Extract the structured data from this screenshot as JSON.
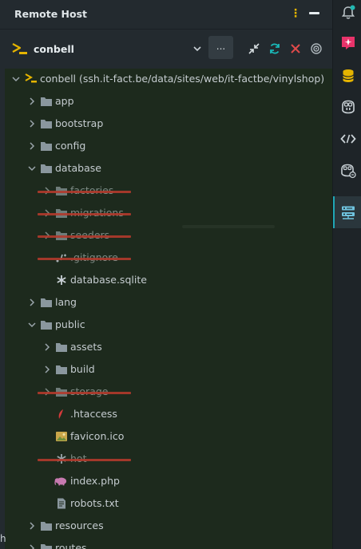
{
  "header": {
    "title": "Remote Host"
  },
  "connection": {
    "name": "conbell",
    "more_label": "..."
  },
  "tree": {
    "root": "conbell (ssh.it-fact.be/data/sites/web/it-factbe/vinylshop)",
    "app": "app",
    "bootstrap": "bootstrap",
    "config": "config",
    "database": "database",
    "factories": "factories",
    "migrations": "migrations",
    "seeders": "seeders",
    "gitignore": ".gitignore",
    "sqlite": "database.sqlite",
    "lang": "lang",
    "public": "public",
    "assets": "assets",
    "build": "build",
    "storage": "storage",
    "htaccess": ".htaccess",
    "favicon": "favicon.ico",
    "hot": "hot",
    "index": "index.php",
    "robots": "robots.txt",
    "resources": "resources",
    "routes": "routes"
  },
  "colors": {
    "accent": "#e5b400",
    "tree_background": "#1d2a1d",
    "strike": "#b23a2c",
    "refresh": "#19b8b8",
    "close": "#e04a4a",
    "selected_tab": "#1fa7b5"
  },
  "activity_bar": [
    "bell-icon",
    "ai-assistant-icon",
    "database-icon",
    "copilot-icon",
    "code-review-icon",
    "copilot-chat-icon",
    "remote-host-icon"
  ],
  "edge_glyph": "h"
}
